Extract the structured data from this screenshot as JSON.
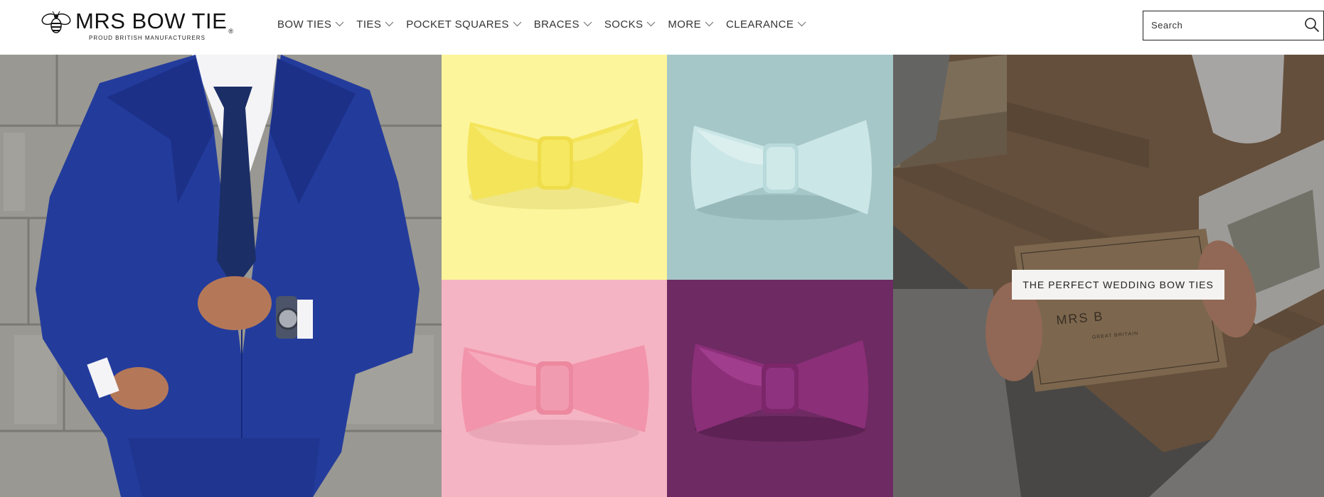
{
  "brand": {
    "name": "MRS BOW TIE",
    "registered": "®",
    "tagline": "PROUD BRITISH MANUFACTURERS"
  },
  "nav": {
    "items": [
      {
        "label": "BOW TIES"
      },
      {
        "label": "TIES"
      },
      {
        "label": "POCKET SQUARES"
      },
      {
        "label": "BRACES"
      },
      {
        "label": "SOCKS"
      },
      {
        "label": "MORE"
      },
      {
        "label": "CLEARANCE"
      }
    ]
  },
  "search": {
    "placeholder": "Search",
    "icon": "search-icon"
  },
  "hero": {
    "wedding_cta": "THE PERFECT WEDDING BOW TIES",
    "box_print": "MRS B",
    "box_sub": "GREAT BRITAIN"
  },
  "colors": {
    "yellow": "#fdf59b",
    "mint": "#a6c7c8",
    "pink": "#f5b4c3",
    "purple": "#6e2a62",
    "suit_blue": "#233c9c"
  }
}
